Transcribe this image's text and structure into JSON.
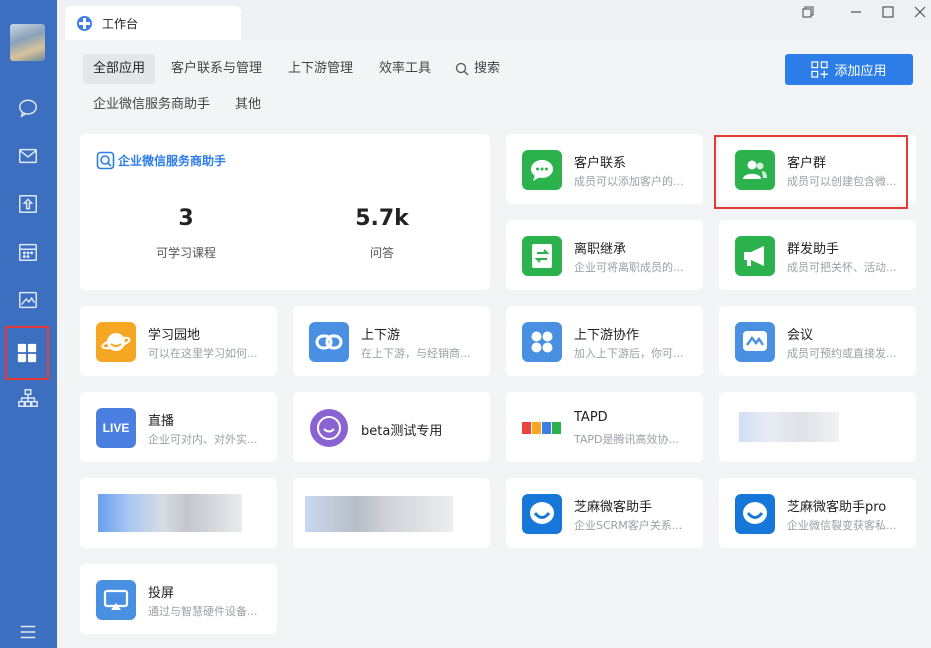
{
  "window": {
    "tab_title": "工作台",
    "controls": [
      "restore-icon",
      "minimize-icon",
      "maximize-icon",
      "close-icon"
    ]
  },
  "sidebar": {
    "items": [
      "chat-icon",
      "mail-icon",
      "docs-icon",
      "calendar-icon",
      "photos-icon",
      "workbench-grid-icon",
      "org-chart-icon",
      "menu-icon"
    ],
    "active": "workbench-grid-icon"
  },
  "nav": {
    "tabs": [
      "全部应用",
      "客户联系与管理",
      "上下游管理",
      "效率工具",
      "搜索",
      "企业微信服务商助手",
      "其他"
    ],
    "active": "全部应用",
    "add_button": "添加应用"
  },
  "assistant_card": {
    "title": "企业微信服务商助手",
    "stats": [
      {
        "value": "3",
        "label": "可学习课程"
      },
      {
        "value": "5.7k",
        "label": "问答"
      }
    ]
  },
  "apps": [
    {
      "name": "客户联系",
      "desc": "成员可以添加客户的...",
      "icon": "chat-bubble-icon",
      "color": "#2bb24c"
    },
    {
      "name": "客户群",
      "desc": "成员可以创建包含微...",
      "icon": "group-users-icon",
      "color": "#2bb24c"
    },
    {
      "name": "离职继承",
      "desc": "企业可将离职成员的...",
      "icon": "transfer-doc-icon",
      "color": "#2bb24c"
    },
    {
      "name": "群发助手",
      "desc": "成员可把关怀、活动...",
      "icon": "megaphone-icon",
      "color": "#2bb24c"
    },
    {
      "name": "学习园地",
      "desc": "可以在这里学习如何...",
      "icon": "planet-icon",
      "color": "#f5a623"
    },
    {
      "name": "上下游",
      "desc": "在上下游，与经销商...",
      "icon": "link-icon",
      "color": "#4a90e2"
    },
    {
      "name": "上下游协作",
      "desc": "加入上下游后，你可...",
      "icon": "four-dots-icon",
      "color": "#4a90e2"
    },
    {
      "name": "会议",
      "desc": "成员可预约或直接发...",
      "icon": "meeting-icon",
      "color": "#4a90e2"
    },
    {
      "name": "直播",
      "desc": "企业可对内、对外实...",
      "icon": "live-icon",
      "icon_text": "LIVE",
      "color": "#4a7fe0"
    },
    {
      "name": "beta测试专用",
      "desc": "",
      "icon": "smile-circle-icon",
      "color": "#8a63d2"
    },
    {
      "name": "TAPD",
      "desc": "TAPD是腾讯高效协...",
      "icon": "tapd-logo-icon",
      "color": "#ffffff"
    },
    {
      "name": "芝麻微客助手",
      "desc": "企业SCRM客户关系...",
      "icon": "smile-bubble-icon",
      "color": "#1677d9"
    },
    {
      "name": "芝麻微客助手pro",
      "desc": "企业微信裂变获客私...",
      "icon": "smile-bubble-icon",
      "color": "#1677d9"
    },
    {
      "name": "投屏",
      "desc": "通过与智慧硬件设备...",
      "icon": "screen-cast-icon",
      "color": "#4a90e2"
    }
  ]
}
